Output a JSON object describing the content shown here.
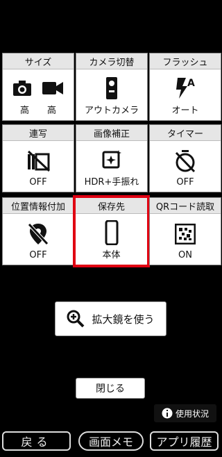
{
  "tiles": [
    {
      "header": "サイズ",
      "values": [
        "高",
        "高"
      ],
      "icons": [
        "camera-icon",
        "video-camera-icon"
      ]
    },
    {
      "header": "カメラ切替",
      "values": [
        "アウトカメラ"
      ],
      "icons": [
        "camera-switch-icon"
      ]
    },
    {
      "header": "フラッシュ",
      "values": [
        "オート"
      ],
      "icons": [
        "flash-auto-icon"
      ]
    },
    {
      "header": "連写",
      "values": [
        "OFF"
      ],
      "icons": [
        "burst-off-icon"
      ]
    },
    {
      "header": "画像補正",
      "values": [
        "HDR+手振れ"
      ],
      "icons": [
        "image-correct-icon"
      ]
    },
    {
      "header": "タイマー",
      "values": [
        "OFF"
      ],
      "icons": [
        "timer-off-icon"
      ]
    },
    {
      "header": "位置情報付加",
      "values": [
        "OFF"
      ],
      "icons": [
        "location-off-icon"
      ]
    },
    {
      "header": "保存先",
      "values": [
        "本体"
      ],
      "icons": [
        "phone-icon"
      ]
    },
    {
      "header": "QRコード読取",
      "values": [
        "ON"
      ],
      "icons": [
        "qr-icon"
      ]
    }
  ],
  "magnifier_label": "拡大鏡を使う",
  "close_label": "閉じる",
  "usage_label": "使用状況",
  "bottom": {
    "back": "戻る",
    "memo": "画面メモ",
    "history": "アプリ履歴"
  },
  "colors": {
    "selected_border": "#e00012"
  }
}
